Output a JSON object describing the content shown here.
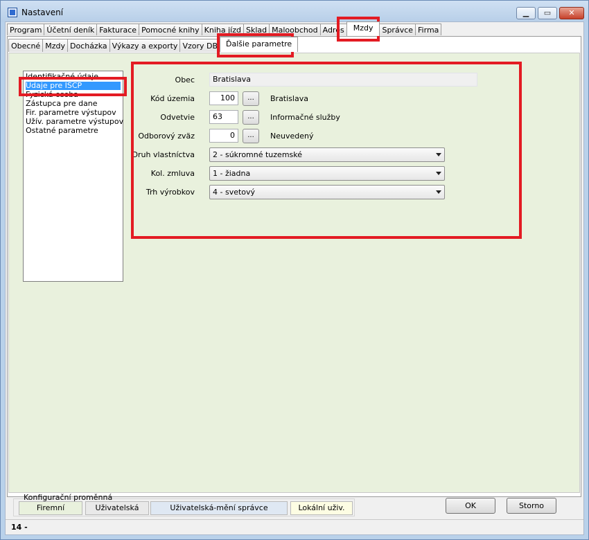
{
  "window": {
    "title": "Nastavení",
    "min_glyph": "▁",
    "max_glyph": "▭",
    "close_glyph": "✕"
  },
  "main_tabs": [
    {
      "label": "Program"
    },
    {
      "label": "Účetní deník"
    },
    {
      "label": "Fakturace"
    },
    {
      "label": "Pomocné knihy"
    },
    {
      "label": "Kniha jízd"
    },
    {
      "label": "Sklad"
    },
    {
      "label": "Maloobchod"
    },
    {
      "label": "Adres"
    },
    {
      "label": "Mzdy",
      "active": true
    },
    {
      "label": "Správce"
    },
    {
      "label": "Firma"
    }
  ],
  "sub_tabs": [
    {
      "label": "Obecné"
    },
    {
      "label": "Mzdy"
    },
    {
      "label": "Docházka"
    },
    {
      "label": "Výkazy a exporty"
    },
    {
      "label": "Vzory DB"
    },
    {
      "label": "Ďalšie parametre",
      "active": true
    }
  ],
  "side_list": {
    "items": [
      "Identifikačné údaje",
      "Údaje pre ISCP",
      "Fyzická osoba",
      "Zástupca pre dane",
      "Fir. parametre výstupov",
      "Užív. parametre výstupov",
      "Ostatné parametre"
    ],
    "selected_index": 1
  },
  "form": {
    "obec": {
      "label": "Obec",
      "value": "Bratislava"
    },
    "kod_uzemia": {
      "label": "Kód územia",
      "value": "100",
      "button": "...",
      "description": "Bratislava"
    },
    "odvetvie": {
      "label": "Odvetvie",
      "value": "63",
      "button": "...",
      "description": "Informačné služby"
    },
    "odborovy_zvaz": {
      "label": "Odborový zväz",
      "value": "0",
      "button": "...",
      "description": "Neuvedený"
    },
    "druh_vlastnictva": {
      "label": "Druh vlastníctva",
      "value": "2 - súkromné tuzemské"
    },
    "kol_zmluva": {
      "label": "Kol. zmluva",
      "value": "1 - žiadna"
    },
    "trh_vyrobkov": {
      "label": "Trh výrobkov",
      "value": "4 - svetový"
    }
  },
  "config": {
    "caption": "Konfigurační proměnná",
    "firemni": "Firemní",
    "uzivatelska": "Uživatelská",
    "uzivatelska_meni_spravce": "Uživatelská-mění správce",
    "lokalni_uziv": "Lokální uživ.",
    "colors": {
      "firemni": "#e9f1dd",
      "uzivatelska": "#e9e9e9",
      "uzivatelska_meni_spravce": "#dfe8f3",
      "lokalni_uziv": "#fdfde3"
    }
  },
  "buttons": {
    "ok": "OK",
    "storno": "Storno"
  },
  "status": {
    "text": "14 -"
  },
  "colors": {
    "highlight": "#e31b23",
    "selection": "#3399ff",
    "pane_bg": "#e9f1dd"
  }
}
